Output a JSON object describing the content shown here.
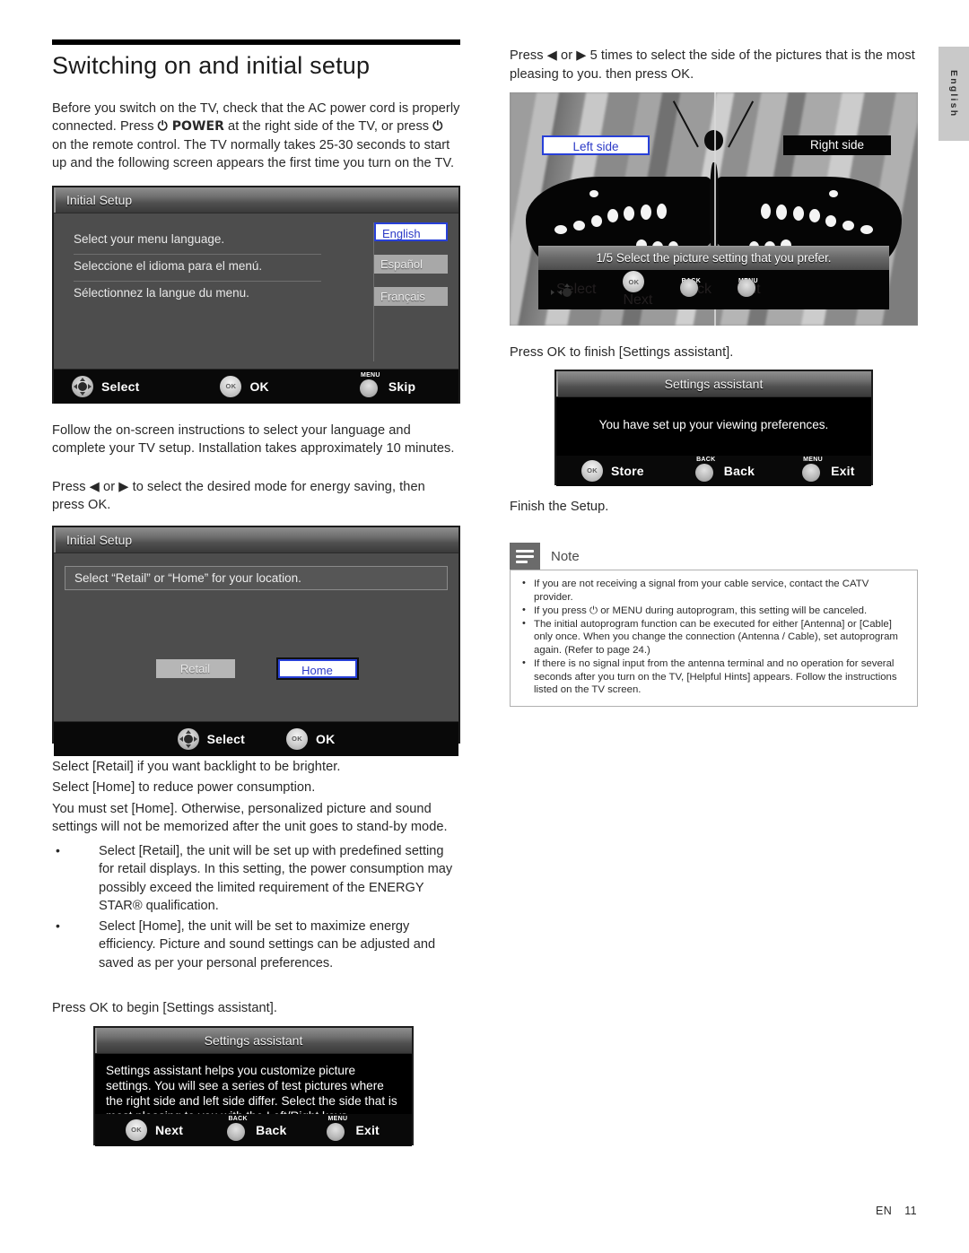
{
  "page": {
    "title": "Switching on and initial setup",
    "footer_lang": "EN",
    "footer_page": "11",
    "side_tab": "English"
  },
  "left": {
    "intro": "Before you switch on the TV, check that the AC power cord is properly connected. Press ⏻ POWER at the right side of the TV, or press ⏻ on the remote control. The TV normally takes 25-30 seconds to start up and and the following screen appears the first time you turn on the TV.",
    "intro_p1": "Before you switch on the TV, check that the AC power cord is properly connected. Press ",
    "intro_power": "⏻ POWER",
    "intro_p2": " at the right side of the TV, or press ",
    "intro_power2": "⏻",
    "intro_p3": " on the remote control. The TV normally takes 25-30 seconds to start up and the following screen appears the first time you turn on the TV.",
    "after_screen1": "Follow the on-screen instructions to select your language and complete your TV setup. Installation takes approximately 10 minutes.",
    "press_energy": "Press ◀ or ▶ to select the desired mode for energy saving, then press OK.",
    "select_retail": "Select [Retail] if you want backlight to be brighter.",
    "select_home": "Select [Home] to reduce power consumption.",
    "must_set_home": "You must set [Home]. Otherwise, personalized picture and sound settings will not be memorized after the unit goes to stand-by mode.",
    "bullets": [
      "Select [Retail], the unit will be set up with predefined setting for retail displays. In this setting, the power consumption may possibly exceed the limited requirement of the ENERGY STAR® qualification.",
      "Select [Home], the unit will be set to maximize energy efficiency. Picture and sound settings can be adjusted and saved as per your personal preferences."
    ],
    "press_ok_begin": "Press OK to begin [Settings assistant]."
  },
  "screen_language": {
    "title": "Initial Setup",
    "rows": [
      "Select your menu language.",
      "Seleccione el idioma para el menú.",
      "Sélectionnez la langue du menu."
    ],
    "options": [
      "English",
      "Español",
      "Français"
    ],
    "selected": "English",
    "bar": [
      {
        "key": "nav",
        "label": "Select"
      },
      {
        "key": "ok",
        "label": "OK"
      },
      {
        "key": "menu",
        "tag": "MENU",
        "label": "Skip"
      }
    ]
  },
  "screen_location": {
    "title": "Initial Setup",
    "banner": "Select “Retail” or “Home” for your location.",
    "buttons": [
      "Retail",
      "Home"
    ],
    "selected": "Home",
    "bar": [
      {
        "key": "nav",
        "label": "Select"
      },
      {
        "key": "ok",
        "label": "OK"
      }
    ]
  },
  "screen_settings_assistant_intro": {
    "title": "Settings assistant",
    "text": "Settings assistant helps you customize picture settings. You will see a series of test pictures where the right side and left side differ. Select the side that is most pleasing to you with the Left/Right keys.",
    "bar": [
      {
        "key": "ok",
        "label": "Next"
      },
      {
        "key": "back",
        "tag": "BACK",
        "label": "Back"
      },
      {
        "key": "menu",
        "tag": "MENU",
        "label": "Exit"
      }
    ]
  },
  "right": {
    "press_side": "Press ◀ or ▶ 5 times to select the side of the pictures that is the most pleasing to you. then press OK.",
    "press_ok_finish": "Press OK to finish [Settings assistant].",
    "finish_setup": "Finish the Setup."
  },
  "screen_picture_test": {
    "left_label": "Left side",
    "right_label": "Right side",
    "selected_side": "Left side",
    "caption": "1/5 Select the picture setting that you prefer.",
    "bar": [
      {
        "key": "nav",
        "label": "Select"
      },
      {
        "key": "ok",
        "label": "Next"
      },
      {
        "key": "back",
        "tag": "BACK",
        "label": "Back"
      },
      {
        "key": "menu",
        "tag": "MENU",
        "label": "Exit"
      }
    ]
  },
  "screen_settings_assistant_done": {
    "title": "Settings assistant",
    "text": "You have set up your viewing preferences.",
    "bar": [
      {
        "key": "ok",
        "label": "Store"
      },
      {
        "key": "back",
        "tag": "BACK",
        "label": "Back"
      },
      {
        "key": "menu",
        "tag": "MENU",
        "label": "Exit"
      }
    ]
  },
  "note": {
    "label": "Note",
    "items": [
      "If you are not receiving a signal from your cable service, contact the CATV provider.",
      "If you press ⏻ or MENU during autoprogram, this setting will be canceled.",
      "The initial autoprogram function can be executed for either [Antenna] or [Cable] only once. When you change the connection (Antenna / Cable), set autoprogram again. (Refer to page 24.)",
      "If there is no signal input from the antenna terminal and no operation for several seconds after you turn on the TV, [Helpful Hints] appears. Follow the instructions listed on the TV screen."
    ]
  },
  "colors": {
    "accent_blue": "#2840d8",
    "osd_gray": "#4d4d4d",
    "osd_black": "#050505"
  }
}
